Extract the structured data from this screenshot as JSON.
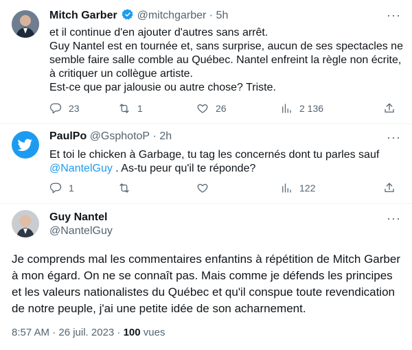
{
  "tweets": [
    {
      "name": "Mitch Garber",
      "handle": "@mitchgarber",
      "time": "5h",
      "verified": true,
      "text": "et il continue d'en ajouter d'autres sans arrêt.\nGuy Nantel est en tournée et, sans surprise, aucun de ses spectacles ne semble faire salle comble au Québec. Nantel enfreint la règle non écrite, à critiquer un collègue artiste.\nEst-ce que par jalousie ou autre chose? Triste.",
      "replies": "23",
      "retweets": "1",
      "likes": "26",
      "views": "2 136"
    },
    {
      "name": "PaulPo",
      "handle": "@GsphotoP",
      "time": "2h",
      "text_before": "Et toi le chicken à Garbage, tu tag les concernés dont tu parles sauf ",
      "mention": "@NantelGuy",
      "text_after": " . As-tu peur qu'il te réponde?",
      "replies": "1",
      "retweets": "",
      "likes": "",
      "views": "122"
    }
  ],
  "main_tweet": {
    "name": "Guy Nantel",
    "handle": "@NantelGuy",
    "text": "Je comprends mal les commentaires enfantins à répétition de Mitch Garber à mon égard. On ne se connaît pas. Mais comme je défends les principes et les valeurs nationalistes du Québec et qu'il conspue toute revendication de notre peuple, j'ai une petite idée de son acharnement.",
    "timestamp": "8:57 AM · 26 juil. 2023 · ",
    "views_count": "100",
    "views_label": " vues"
  },
  "colors": {
    "accent": "#1d9bf0",
    "secondary": "#536471",
    "text": "#0f1419"
  },
  "icons": [
    "more-icon",
    "reply-icon",
    "retweet-icon",
    "like-icon",
    "views-icon",
    "share-icon",
    "verified-icon",
    "twitter-bird-icon"
  ]
}
